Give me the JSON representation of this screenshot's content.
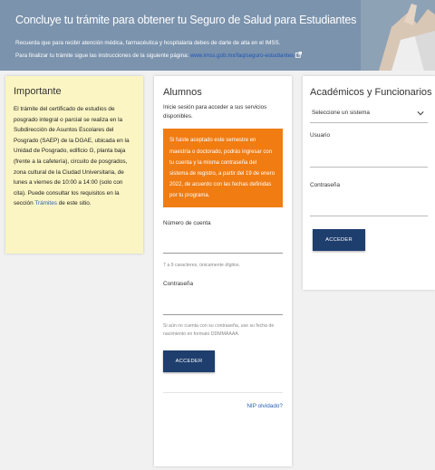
{
  "banner": {
    "title": "Concluye tu trámite para obtener tu Seguro de Salud para Estudiantes",
    "line1": "Recuerda que para recibir atención médica, farmacéutica y hospitalaria debes de darte de alta en el IMSS.",
    "line2_prefix": "Para finalizar tu trámite sigue las instrucciones de la siguiente página:",
    "link": "www.imss.gob.mx/faq/seguro-estudiantes",
    "link_icon": "external-link-icon"
  },
  "importante": {
    "title": "Importante",
    "text_before_link": "El trámite del certificado de estudios de posgrado integral o parcial se realiza en la Subdirección de Asuntos Escolares del Posgrado (SAEP) de la DGAE, ubicada en la Unidad de Posgrado, edificio G, planta baja (frente a la cafetería), circuito de posgrados, zona cultural de la Ciudad Universitaria, de lunes a viernes de 10:00 a 14:00 (solo con cita). Puede consultar los requisitos en la sección",
    "link": "Trámites",
    "text_after_link": "de este sitio."
  },
  "alumnos": {
    "title": "Alumnos",
    "intro": "Inicie sesión para acceder a sus servicios disponibles.",
    "notice": "Si fuiste aceptado este semestre en maestría o doctorado, podrás ingresar con tu cuenta y la misma contraseña del sistema de registro, a partir del 19 de enero 2022, de acuerdo con las fechas definidas por tu programa.",
    "account_label": "Número de cuenta",
    "account_value": "",
    "account_hint": "7 a 9 caracteres, únicamente dígitos.",
    "password_label": "Contraseña",
    "password_value": "",
    "password_hint": "Si aún no cuenta con su contraseña, use su fecha de nacimiento en formato DDMMAAAA.",
    "submit": "ACCEDER",
    "forgot": "NIP olvidado?"
  },
  "academicos": {
    "title": "Académicos y Funcionarios",
    "system_select": "Seleccione un sistema",
    "user_label": "Usuario",
    "user_value": "",
    "password_label": "Contraseña",
    "password_value": "",
    "submit": "ACCEDER"
  },
  "colors": {
    "banner": "#7b93ad",
    "notice": "#f07c12",
    "button": "#1e3e6e",
    "importante_bg": "#fbf5c3",
    "link": "#2b62b6"
  }
}
